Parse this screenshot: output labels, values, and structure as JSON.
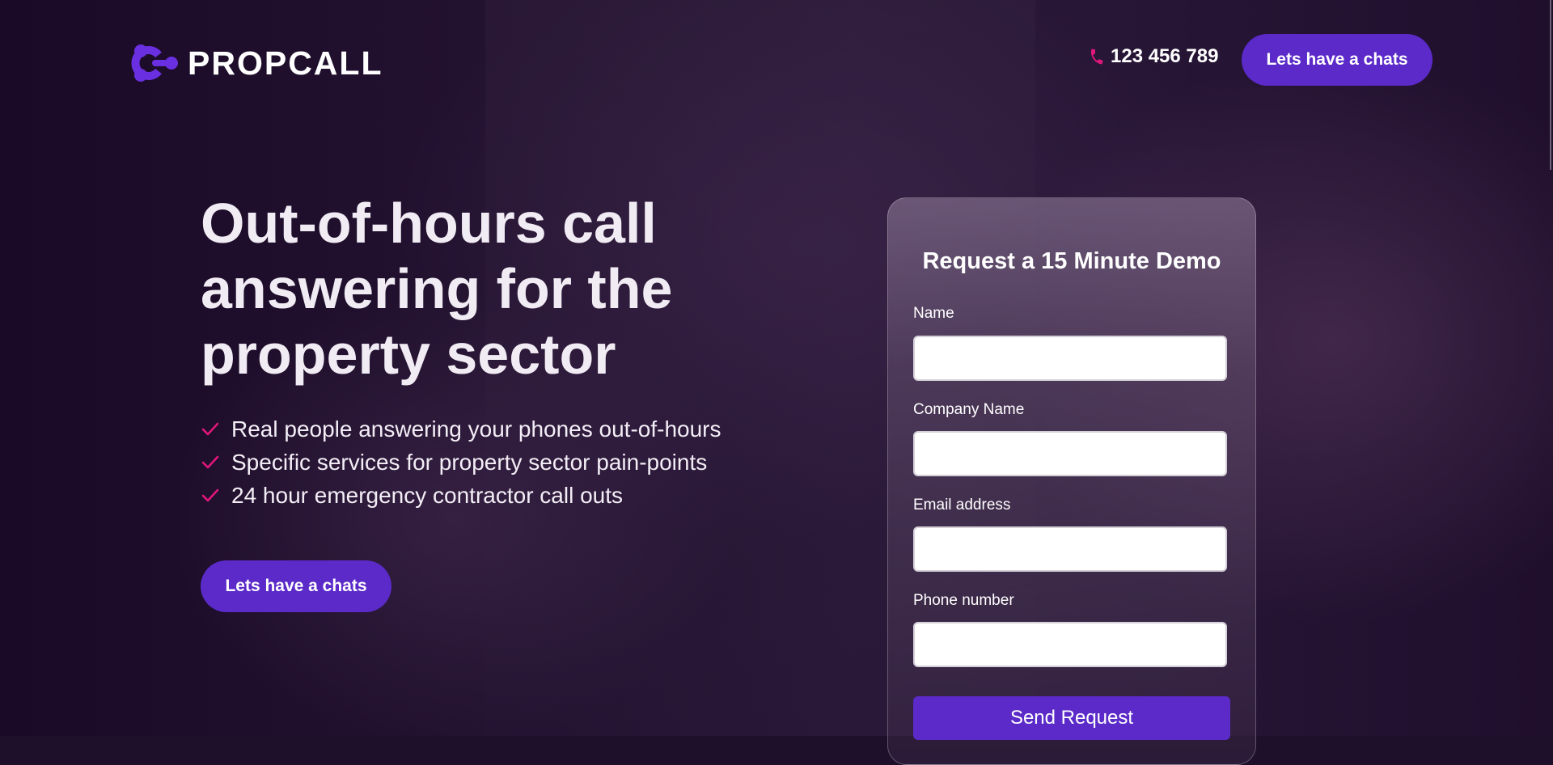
{
  "brand": {
    "name": "PROPCALL",
    "logo_icon": "propcall-logo-icon",
    "accent": "#5b2ac9",
    "pink": "#e0177a"
  },
  "header": {
    "phone_icon": "phone-icon",
    "phone_number": "123 456 789",
    "cta_label": "Lets have a chats"
  },
  "hero": {
    "title": "Out-of-hours call answering for the property sector",
    "bullets": [
      "Real people answering your phones out-of-hours",
      "Specific services for property sector pain-points",
      "24 hour emergency contractor call outs"
    ],
    "cta_label": "Lets have a chats"
  },
  "form": {
    "title": "Request a 15 Minute Demo",
    "fields": [
      {
        "label": "Name",
        "value": ""
      },
      {
        "label": "Company Name",
        "value": ""
      },
      {
        "label": "Email address",
        "value": ""
      },
      {
        "label": "Phone number",
        "value": ""
      }
    ],
    "submit_label": "Send Request"
  }
}
